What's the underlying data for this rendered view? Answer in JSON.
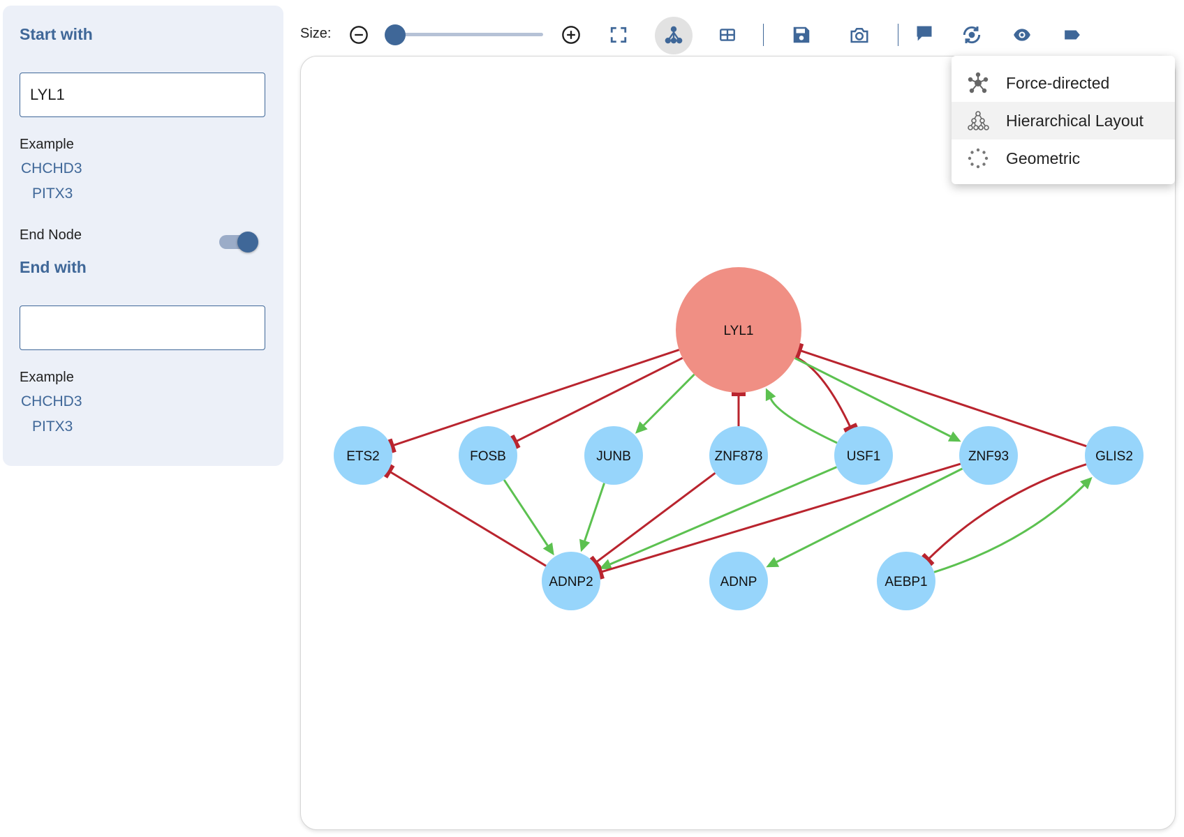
{
  "sidebar": {
    "start_title": "Start with",
    "start_value": "LYL1",
    "start_example_label": "Example",
    "start_examples": [
      "CHCHD3",
      "PITX3"
    ],
    "end_node_label": "End Node",
    "end_node_enabled": true,
    "end_title": "End with",
    "end_value": "",
    "end_example_label": "Example",
    "end_examples": [
      "CHCHD3",
      "PITX3"
    ]
  },
  "toolbar": {
    "size_label": "Size:",
    "size_slider_fraction": 0.04,
    "icons": [
      "zoom-out-icon",
      "zoom-in-icon",
      "fit-screen-icon",
      "layout-icon",
      "table-icon",
      "save-icon",
      "camera-icon",
      "comment-icon",
      "refresh-icon",
      "eye-icon",
      "label-icon"
    ],
    "active_icon": "layout-icon",
    "accent_color": "#3f6798"
  },
  "layout_menu": {
    "items": [
      {
        "label": "Force-directed",
        "icon": "force-directed-icon"
      },
      {
        "label": "Hierarchical Layout",
        "icon": "hierarchical-icon",
        "highlighted": true
      },
      {
        "label": "Geometric",
        "icon": "geometric-icon"
      }
    ]
  },
  "network": {
    "colors": {
      "root_node": "#f08f84",
      "node": "#97d5fb",
      "activation": "#5cc150",
      "inhibition": "#b9242e"
    },
    "nodes": [
      {
        "id": "LYL1",
        "root": true
      },
      {
        "id": "ETS2"
      },
      {
        "id": "FOSB"
      },
      {
        "id": "JUNB"
      },
      {
        "id": "ZNF878"
      },
      {
        "id": "USF1"
      },
      {
        "id": "ZNF93"
      },
      {
        "id": "GLIS2"
      },
      {
        "id": "ADNP2"
      },
      {
        "id": "ADNP"
      },
      {
        "id": "AEBP1"
      }
    ],
    "edges": [
      {
        "source": "LYL1",
        "target": "ETS2",
        "type": "inhibition"
      },
      {
        "source": "LYL1",
        "target": "FOSB",
        "type": "inhibition"
      },
      {
        "source": "LYL1",
        "target": "JUNB",
        "type": "activation"
      },
      {
        "source": "ZNF878",
        "target": "LYL1",
        "type": "inhibition"
      },
      {
        "source": "LYL1",
        "target": "USF1",
        "type": "inhibition"
      },
      {
        "source": "USF1",
        "target": "LYL1",
        "type": "activation"
      },
      {
        "source": "LYL1",
        "target": "ZNF93",
        "type": "activation"
      },
      {
        "source": "GLIS2",
        "target": "LYL1",
        "type": "inhibition"
      },
      {
        "source": "ADNP2",
        "target": "ETS2",
        "type": "inhibition"
      },
      {
        "source": "FOSB",
        "target": "ADNP2",
        "type": "activation"
      },
      {
        "source": "JUNB",
        "target": "ADNP2",
        "type": "activation"
      },
      {
        "source": "ZNF878",
        "target": "ADNP2",
        "type": "inhibition"
      },
      {
        "source": "USF1",
        "target": "ADNP2",
        "type": "activation"
      },
      {
        "source": "ZNF93",
        "target": "ADNP2",
        "type": "inhibition"
      },
      {
        "source": "ZNF93",
        "target": "ADNP",
        "type": "activation"
      },
      {
        "source": "AEBP1",
        "target": "GLIS2",
        "type": "activation"
      },
      {
        "source": "GLIS2",
        "target": "AEBP1",
        "type": "inhibition"
      }
    ]
  }
}
